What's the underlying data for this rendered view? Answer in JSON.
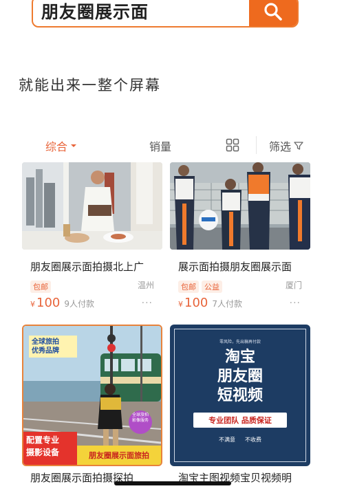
{
  "search": {
    "query": "朋友圈展示面"
  },
  "subtitle": "就能出来一整个屏幕",
  "sortbar": {
    "items": [
      {
        "label": "综合"
      },
      {
        "label": "销量"
      },
      {
        "label": "筛选"
      }
    ]
  },
  "products": [
    {
      "title": "朋友圈展示面拍摄北上广",
      "tags": [
        "包邮"
      ],
      "city": "温州",
      "currency": "¥",
      "price": "100",
      "sold": "9人付款",
      "more": "···"
    },
    {
      "title": "展示面拍摄朋友圈展示面",
      "tags": [
        "包邮",
        "公益"
      ],
      "city": "厦门",
      "currency": "¥",
      "price": "100",
      "sold": "7人付款",
      "more": "···"
    },
    {
      "title": "朋友圈展示面拍摄探拍",
      "overlay": {
        "badge_line1": "全球旅拍",
        "badge_line2": "优秀品牌",
        "bottom_left_1": "配置专业",
        "bottom_left_2": "摄影设备",
        "bottom_right": "朋友圈展示面旅拍",
        "circle_text": "全球旅拍 影像服务"
      }
    },
    {
      "title": "淘宝主图视频宝贝视频明",
      "overlay": {
        "small_top": "零风险，先出稿再付款",
        "line1": "淘宝",
        "line2": "朋友圈",
        "line3": "短视频",
        "banner": "专业团队 品质保证",
        "foot_1": "不满意",
        "foot_2": "不收费"
      }
    }
  ],
  "colors": {
    "accent": "#ee6a1e",
    "price": "#e8643a"
  }
}
